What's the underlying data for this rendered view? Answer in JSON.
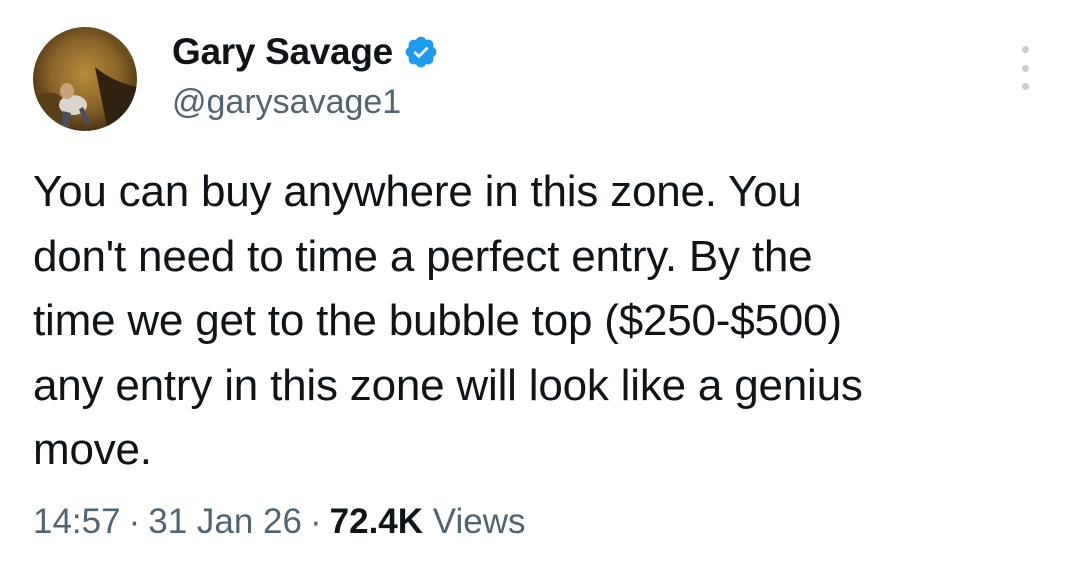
{
  "author": {
    "display_name": "Gary Savage",
    "handle": "@garysavage1",
    "verified": true
  },
  "icons": {
    "verified": "verified-badge-icon",
    "more": "more-options-icon"
  },
  "colors": {
    "text_primary": "#0f1419",
    "text_secondary": "#536471",
    "verified_blue": "#1d9bf0"
  },
  "tweet": {
    "text": "You can buy anywhere in this zone. You\ndon't need to time a perfect entry. By the\ntime we get to the bubble top ($250-$500)\nany entry in this zone will look like a genius\nmove."
  },
  "meta": {
    "time": "14:57",
    "separator": "·",
    "date": "31 Jan 26",
    "views_count": "72.4K",
    "views_label": "Views"
  }
}
